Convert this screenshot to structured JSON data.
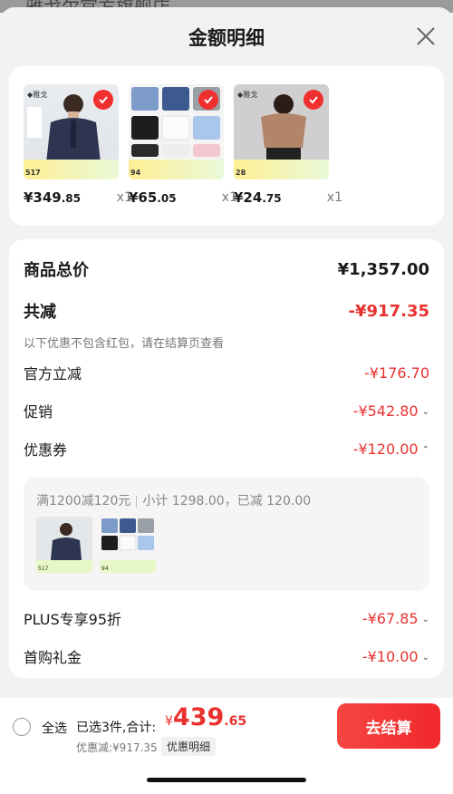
{
  "background": {
    "store_name": "雅戈尔官方旗舰店"
  },
  "header": {
    "title": "金额明细"
  },
  "products": [
    {
      "price_int": "¥349",
      "price_dec": ".85",
      "qty": "x1",
      "sold": "517",
      "color": "#2e3550"
    },
    {
      "price_int": "¥65",
      "price_dec": ".05",
      "qty": "x1",
      "sold": "94",
      "color": "#6a86b8"
    },
    {
      "price_int": "¥24",
      "price_dec": ".75",
      "qty": "x1",
      "sold": "28",
      "color": "#b28468"
    }
  ],
  "summary": {
    "total_label": "商品总价",
    "total_value": "¥1,357.00",
    "reduce_label": "共减",
    "reduce_value": "-¥917.35",
    "note": "以下优惠不包含红包，请在结算页查看",
    "official_label": "官方立减",
    "official_value": "-¥176.70",
    "promo_label": "促销",
    "promo_value": "-¥542.80",
    "coupon_label": "优惠券",
    "coupon_value": "-¥120.00",
    "coupon_rule": "满1200减120元",
    "coupon_subtotal": "小计 1298.00，已减 120.00",
    "plus_label": "PLUS专享95折",
    "plus_value": "-¥67.85",
    "first_label": "首购礼金",
    "first_value": "-¥10.00"
  },
  "bottom": {
    "select_all": "全选",
    "selected": "已选3件,合计:",
    "symbol": "¥",
    "total_int": "439",
    "total_dec": ".65",
    "discount": "优惠减:¥917.35",
    "detail": "优惠明细",
    "checkout": "去结算"
  },
  "colors": {
    "accent": "#e8322f",
    "button": "#f2282b"
  }
}
